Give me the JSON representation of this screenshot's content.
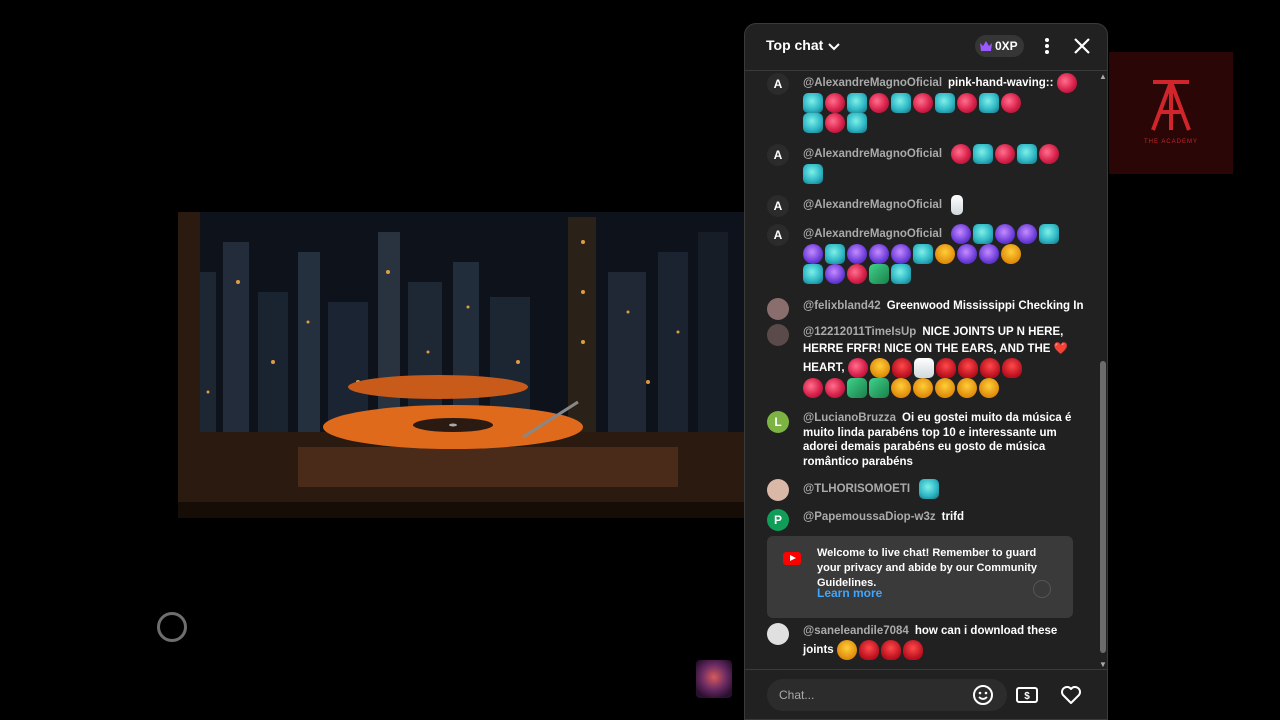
{
  "chat": {
    "header": {
      "title": "Top chat",
      "xp_label": "0XP"
    },
    "messages": [
      {
        "author": "@AlexandreMagnoOficial",
        "text": "pink-hand-waving::",
        "avatar_letter": "A",
        "avatar_color": "#2b2b2b"
      },
      {
        "author": "@AlexandreMagnoOficial",
        "text": "",
        "avatar_letter": "A",
        "avatar_color": "#2b2b2b"
      },
      {
        "author": "@AlexandreMagnoOficial",
        "text": "",
        "avatar_letter": "A",
        "avatar_color": "#2b2b2b"
      },
      {
        "author": "@AlexandreMagnoOficial",
        "text": "",
        "avatar_letter": "A",
        "avatar_color": "#2b2b2b"
      },
      {
        "author": "@felixbland42",
        "text": "Greenwood Mississippi Checking In",
        "avatar_letter": "",
        "avatar_color": "#8a6d6d"
      },
      {
        "author": "@12212011TimeIsUp",
        "text": "NICE JOINTS UP N HERE, HERRE FRFR! NICE ON THE EARS, AND THE ❤️ HEART,",
        "avatar_letter": "",
        "avatar_color": "#5a4a4a"
      },
      {
        "author": "@LucianoBruzza",
        "text": "Oi eu gostei muito da música é muito linda parabéns top 10 e interessante um adorei demais parabéns eu gosto de música romântico parabéns",
        "avatar_letter": "L",
        "avatar_color": "#7cb342"
      },
      {
        "author": "@TLHORISOMOETI",
        "text": "",
        "avatar_letter": "",
        "avatar_color": "#d9b8a8"
      },
      {
        "author": "@PapemoussaDiop-w3z",
        "text": "trifd",
        "avatar_letter": "P",
        "avatar_color": "#0f9d58"
      },
      {
        "author": "@saneleandile7084",
        "text": "how can i download these joints",
        "avatar_letter": "",
        "avatar_color": "#e0e0e0"
      }
    ],
    "welcome": {
      "text": "Welcome to live chat! Remember to guard your privacy and abide by our Community Guidelines.",
      "link": "Learn more"
    },
    "input": {
      "placeholder": "Chat..."
    }
  },
  "academy_logo": {
    "text": "THE ACADEMY"
  },
  "colors": {
    "accent_link": "#3ea6ff",
    "panel_bg": "#212121",
    "xp_crown": "#9b59ff"
  },
  "icons": [
    "chevron-down-icon",
    "crown-icon",
    "more-vert-icon",
    "close-icon",
    "emoji-icon",
    "super-chat-icon",
    "heart-icon",
    "youtube-icon"
  ]
}
